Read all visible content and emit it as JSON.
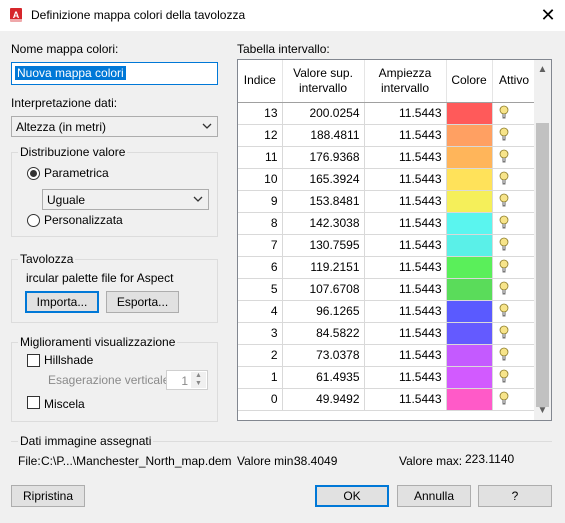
{
  "window": {
    "title": "Definizione mappa colori della tavolozza",
    "app_icon_letter": "A"
  },
  "name_section": {
    "label": "Nome mappa colori:",
    "value": "Nuova mappa colori"
  },
  "interpretation": {
    "label": "Interpretazione dati:",
    "value": "Altezza (in metri)"
  },
  "distribution": {
    "title": "Distribuzione valore",
    "parametric_label": "Parametrica",
    "parametric_selected": true,
    "parametric_combo_value": "Uguale",
    "custom_label": "Personalizzata"
  },
  "palette": {
    "title": "Tavolozza",
    "description": "ircular palette file for Aspect",
    "import_label": "Importa...",
    "export_label": "Esporta..."
  },
  "display": {
    "title": "Miglioramenti visualizzazione",
    "hillshade_label": "Hillshade",
    "vertical_exaggeration_label": "Esagerazione verticale",
    "vertical_exaggeration_value": "1",
    "blend_label": "Miscela"
  },
  "table": {
    "label": "Tabella intervallo:",
    "headers": {
      "index": "Indice",
      "upper": "Valore sup. intervallo",
      "width": "Ampiezza intervallo",
      "color": "Colore",
      "active": "Attivo"
    },
    "rows": [
      {
        "index": "13",
        "upper": "200.0254",
        "width": "11.5443",
        "color": "#ff5a5a",
        "active_icon": "lightbulb-icon"
      },
      {
        "index": "12",
        "upper": "188.4811",
        "width": "11.5443",
        "color": "#ffa062",
        "active_icon": "lightbulb-icon"
      },
      {
        "index": "11",
        "upper": "176.9368",
        "width": "11.5443",
        "color": "#ffb55a",
        "active_icon": "lightbulb-icon"
      },
      {
        "index": "10",
        "upper": "165.3924",
        "width": "11.5443",
        "color": "#ffe25a",
        "active_icon": "lightbulb-icon"
      },
      {
        "index": "9",
        "upper": "153.8481",
        "width": "11.5443",
        "color": "#f5ef5a",
        "active_icon": "lightbulb-icon"
      },
      {
        "index": "8",
        "upper": "142.3038",
        "width": "11.5443",
        "color": "#5af5ef",
        "active_icon": "lightbulb-icon"
      },
      {
        "index": "7",
        "upper": "130.7595",
        "width": "11.5443",
        "color": "#5af0e8",
        "active_icon": "lightbulb-icon"
      },
      {
        "index": "6",
        "upper": "119.2151",
        "width": "11.5443",
        "color": "#5aef5a",
        "active_icon": "lightbulb-icon"
      },
      {
        "index": "5",
        "upper": "107.6708",
        "width": "11.5443",
        "color": "#5adc5a",
        "active_icon": "lightbulb-icon"
      },
      {
        "index": "4",
        "upper": "96.1265",
        "width": "11.5443",
        "color": "#5a5aff",
        "active_icon": "lightbulb-icon"
      },
      {
        "index": "3",
        "upper": "84.5822",
        "width": "11.5443",
        "color": "#645aff",
        "active_icon": "lightbulb-icon"
      },
      {
        "index": "2",
        "upper": "73.0378",
        "width": "11.5443",
        "color": "#c45aff",
        "active_icon": "lightbulb-icon"
      },
      {
        "index": "1",
        "upper": "61.4935",
        "width": "11.5443",
        "color": "#d25aff",
        "active_icon": "lightbulb-icon"
      },
      {
        "index": "0",
        "upper": "49.9492",
        "width": "11.5443",
        "color": "#ff5ac8",
        "active_icon": "lightbulb-icon"
      }
    ]
  },
  "image_data": {
    "title": "Dati immagine assegnati",
    "file_label": "File:",
    "file_value": "C:\\P...\\Manchester_North_map.dem",
    "min_label": "Valore min:",
    "min_value": "38.4049",
    "max_label": "Valore max:",
    "max_value": "223.1140"
  },
  "buttons": {
    "reset": "Ripristina",
    "ok": "OK",
    "cancel": "Annulla",
    "help": "?"
  },
  "colors": {
    "accent": "#0078d7",
    "window_bg": "#f0f0f0",
    "bulb": "#f7e48a"
  }
}
